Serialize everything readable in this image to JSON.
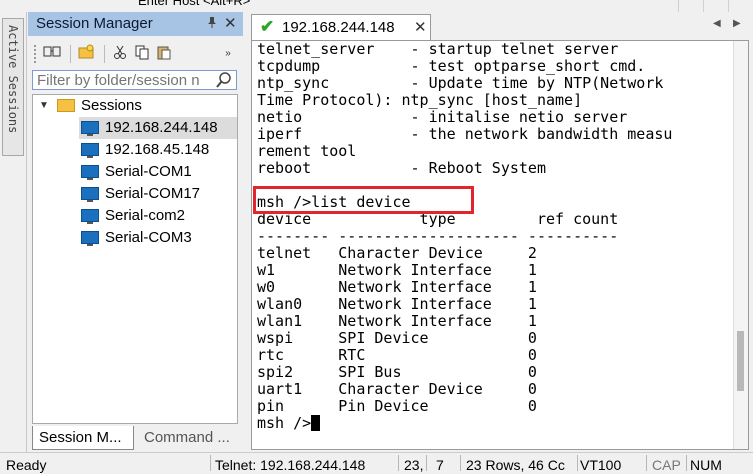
{
  "toolbar_hint": "Enter Host <Alt+R>",
  "active_sessions_label": "Active Sessions",
  "session_manager": {
    "title": "Session Manager",
    "pin_glyph": "📌",
    "close_glyph": "✕",
    "toolbar": {
      "icons": [
        "connect-icon",
        "new-folder-icon",
        "cut-icon",
        "copy-icon",
        "paste-icon",
        "more-icon"
      ]
    },
    "filter_placeholder": "Filter by folder/session n",
    "tree": {
      "folder": "Sessions",
      "items": [
        "192.168.244.148",
        "192.168.45.148",
        "Serial-COM1",
        "Serial-COM17",
        "Serial-com2",
        "Serial-COM3"
      ],
      "selected_index": 0
    },
    "tabs": [
      "Session M...",
      "Command ..."
    ]
  },
  "session_tab": {
    "label": "192.168.244.148",
    "status_glyph": "✔",
    "close_glyph": "✕"
  },
  "terminal": {
    "lines": [
      "telnet_server    - startup telnet server",
      "tcpdump          - test optparse_short cmd.",
      "ntp_sync         - Update time by NTP(Network",
      "Time Protocol): ntp_sync [host_name]",
      "netio            - initalise netio server",
      "iperf            - the network bandwidth measu",
      "rement tool",
      "reboot           - Reboot System",
      "",
      "msh />list device",
      "device            type         ref count",
      "-------- -------------------- ----------",
      "telnet   Character Device     2",
      "w1       Network Interface    1",
      "w0       Network Interface    1",
      "wlan0    Network Interface    1",
      "wlan1    Network Interface    1",
      "wspi     SPI Device           0",
      "rtc      RTC                  0",
      "spi2     SPI Bus              0",
      "uart1    Character Device     0",
      "pin      Pin Device           0"
    ],
    "prompt": "msh />",
    "highlight_color": "#e0252e"
  },
  "status_bar": {
    "ready": "Ready",
    "connection": "Telnet: 192.168.244.148",
    "row": "23,",
    "col": "7",
    "size": "23 Rows, 46 Cc",
    "emulation": "VT100",
    "cap": "CAP",
    "num": "NUM"
  },
  "colors": {
    "panel_header": "#a8c4e4",
    "session_ok": "#2aa52a",
    "monitor_icon": "#1b6fbf",
    "folder_icon": "#f6c142"
  }
}
